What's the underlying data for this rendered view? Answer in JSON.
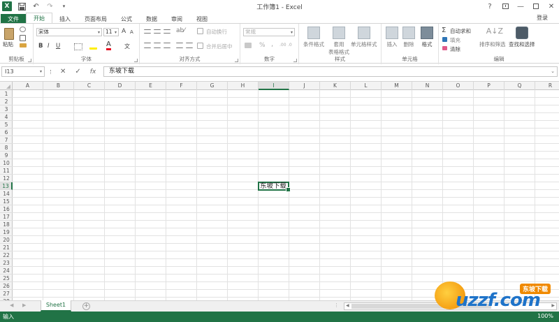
{
  "window": {
    "title": "工作簿1 - Excel",
    "app_logo": "X",
    "help": "?",
    "controls": [
      "restore-ribbon",
      "minimize",
      "maximize",
      "close"
    ]
  },
  "ribbon_tabs": {
    "file": "文件",
    "tabs": [
      "开始",
      "插入",
      "页面布局",
      "公式",
      "数据",
      "审阅",
      "视图"
    ],
    "active": "开始",
    "sign_in": "登录"
  },
  "ribbon": {
    "clipboard": {
      "label": "剪贴板",
      "paste": "粘贴"
    },
    "font": {
      "label": "字体",
      "font_name": "宋体",
      "font_size": "11",
      "bold": "B",
      "italic": "I",
      "underline": "U",
      "font_color_letter": "A",
      "grow": "A",
      "shrink": "A"
    },
    "alignment": {
      "label": "对齐方式",
      "wrap_text": "自动换行",
      "merge_center": "合并后居中"
    },
    "number": {
      "label": "数字",
      "format": "常规",
      "percent": "%",
      "comma": ","
    },
    "styles": {
      "label": "样式",
      "conditional": "条件格式",
      "table_line1": "套用",
      "table_line2": "表格格式",
      "cell_styles": "单元格样式"
    },
    "cells": {
      "label": "单元格",
      "insert": "插入",
      "delete": "删除",
      "format": "格式"
    },
    "editing": {
      "label": "编辑",
      "autosum": "自动求和",
      "fill": "填充",
      "clear": "清除",
      "sort_filter": "排序和筛选",
      "find_select": "查找和选择"
    }
  },
  "formula_bar": {
    "name_box": "I13",
    "cancel": "✕",
    "enter": "✓",
    "fx": "fx",
    "content": "东坡下载"
  },
  "grid": {
    "columns": [
      "A",
      "B",
      "C",
      "D",
      "E",
      "F",
      "G",
      "H",
      "I",
      "J",
      "K",
      "L",
      "M",
      "N",
      "O",
      "P",
      "Q",
      "R"
    ],
    "rows": [
      "1",
      "2",
      "3",
      "4",
      "5",
      "6",
      "7",
      "8",
      "9",
      "10",
      "11",
      "12",
      "13",
      "14",
      "15",
      "16",
      "17",
      "18",
      "19",
      "20",
      "21",
      "22",
      "23",
      "24",
      "25",
      "26",
      "27",
      "28"
    ],
    "selected_column": "I",
    "selected_row": "13",
    "active_cell_text": "东坡下载"
  },
  "sheets": {
    "tabs": [
      "Sheet1"
    ],
    "add": "+"
  },
  "status": {
    "mode": "输入",
    "zoom": "100%"
  },
  "watermark": {
    "brand": "uzzf.com",
    "tag": "东坡下载"
  }
}
